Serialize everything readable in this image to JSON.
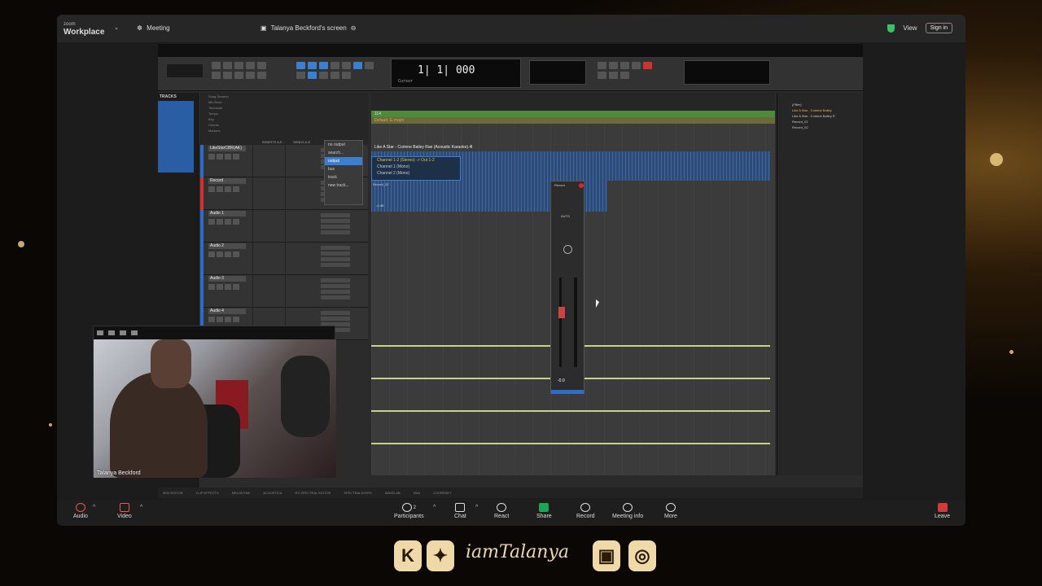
{
  "zoom": {
    "app_small": "zoom",
    "app_name": "Workplace",
    "meeting_label": "Meeting",
    "screen_label": "Talanya Beckford's screen",
    "view_label": "View",
    "signin_label": "Sign in"
  },
  "daw": {
    "counter_main": "1| 1| 000",
    "counter_label": "Cursor",
    "tracks_header": "TRACKS",
    "header_rows": [
      "Song Session",
      "Min:Secs",
      "Timecode",
      "Tempo",
      "Key",
      "Chords",
      "Markers"
    ],
    "col_inserts": "INSERTS A-E",
    "col_sends": "SENDS A-E",
    "marker_text": "114",
    "key_text": "Default: G major",
    "clip_title": "Like A Star - Corinne Bailey Rae (Acoustic Karaoke).4l",
    "clip2_label": "Record_02",
    "clip2_db": "-6 dB",
    "tracks": [
      {
        "name": "LikeStarCBR(AK)"
      },
      {
        "name": "Record"
      },
      {
        "name": "Audio 1"
      },
      {
        "name": "Audio 2"
      },
      {
        "name": "Audio 3"
      },
      {
        "name": "Audio 4"
      }
    ],
    "dropdown": [
      "no output",
      "search...",
      "output",
      "bus",
      "track",
      "new track..."
    ],
    "submenu": [
      "Channel 1-2 (Stereo) -> Out 1-2",
      "Channel 1 (Mono)",
      "Channel 2 (Mono)"
    ],
    "mixer": {
      "name": "Record",
      "auto": "AUTO",
      "vol": "-0.0"
    },
    "clip_list": [
      "Like A Star - Corinne Bailey",
      "Like A Star - Corinne Bailey R",
      "Record_01",
      "Record_02"
    ],
    "clip_filter": "(Filter)",
    "bottom_tabs": [
      "MIDI EDITOR",
      "CLIP EFFECTS",
      "MELODYNE",
      "ACOUSTICA",
      "RX SPECTRAL EDITOR",
      "SPECTRALAYERS",
      "WAVELAB",
      "DNA",
      "CHORDSET"
    ]
  },
  "webcam": {
    "name": "Talanya Beckford"
  },
  "bottombar": {
    "audio": "Audio",
    "video": "Video",
    "participants": "Participants",
    "participants_count": "2",
    "chat": "Chat",
    "react": "React",
    "share": "Share",
    "record": "Record",
    "meeting_info": "Meeting info",
    "more": "More",
    "leave": "Leave"
  },
  "social": {
    "handle": "iamTalanya"
  },
  "colors": {
    "share_green": "#1ea752",
    "leave_red": "#d43a3a",
    "daw_blue": "#3a7fd0",
    "gold": "#f0d9a8"
  }
}
